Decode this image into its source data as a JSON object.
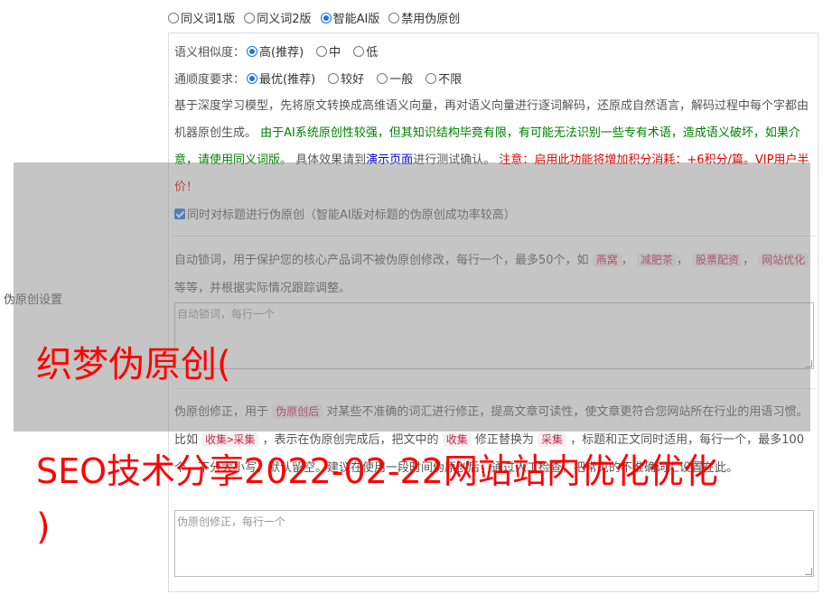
{
  "modes": [
    {
      "label": "同义词1版",
      "checked": false
    },
    {
      "label": "同义词2版",
      "checked": false
    },
    {
      "label": "智能AI版",
      "checked": true
    },
    {
      "label": "禁用伪原创",
      "checked": false
    }
  ],
  "similarity": {
    "label": "语义相似度：",
    "options": [
      {
        "label": "高(推荐)",
        "checked": true
      },
      {
        "label": "中",
        "checked": false
      },
      {
        "label": "低",
        "checked": false
      }
    ]
  },
  "fluency": {
    "label": "通顺度要求：",
    "options": [
      {
        "label": "最优(推荐)",
        "checked": true
      },
      {
        "label": "较好",
        "checked": false
      },
      {
        "label": "一般",
        "checked": false
      },
      {
        "label": "不限",
        "checked": false
      }
    ]
  },
  "description": {
    "part1": "基于深度学习模型，先将原文转换成高维语义向量，再对语义向量进行逐词解码，还原成自然语言，解码过程中每个字都由机器原创生成。",
    "warning_green": "由于AI系统原创性较强，但其知识结构毕竟有限，有可能无法识别一些专有术语，造成语义破坏，如果介意，请使用同义词版。",
    "part2": "具体效果请到",
    "demo_link": "演示页面",
    "part3": "进行测试确认。",
    "notice_red": "注意：启用此功能将增加积分消耗：+6积分/篇。VIP用户半价！"
  },
  "title_checkbox": {
    "label": "同时对标题进行伪原创（智能AI版对标题的伪原创成功率较高）",
    "checked": true
  },
  "side_label": "伪原创设置",
  "lock": {
    "text_before": "自动锁词，用于保护您的核心产品词不被伪原创修改，每行一个，最多50个，如",
    "examples": [
      "燕窝",
      "减肥茶",
      "股票配资",
      "网站优化"
    ],
    "separator": "，",
    "text_after": "等等，并根据实际情况跟踪调整。",
    "placeholder": "自动锁词，每行一个"
  },
  "fix": {
    "t1": "伪原创修正，用于",
    "code1": "伪原创后",
    "t2": "对某些不准确的词汇进行修正，提高文章可读性，使文章更符合您网站所在行业的用语习惯。比如",
    "code2": "收集>采集",
    "t3": "，表示在伪原创完成后，把文中的",
    "code3": "收集",
    "t4": "修正替换为",
    "code4": "采集",
    "t5": "，标题和正文同时适用，每行一个，最多100个，不分大小写，默认留空。建议在使用一段时间伪原创后，通过人工检查，把常见的不准确词汇设置在此。",
    "placeholder": "伪原创修正，每行一个"
  },
  "watermark": {
    "line1": "织梦伪原创(",
    "line2": "SEO技术分享2022-02-22网站站内优化优化",
    "line3": ")"
  }
}
